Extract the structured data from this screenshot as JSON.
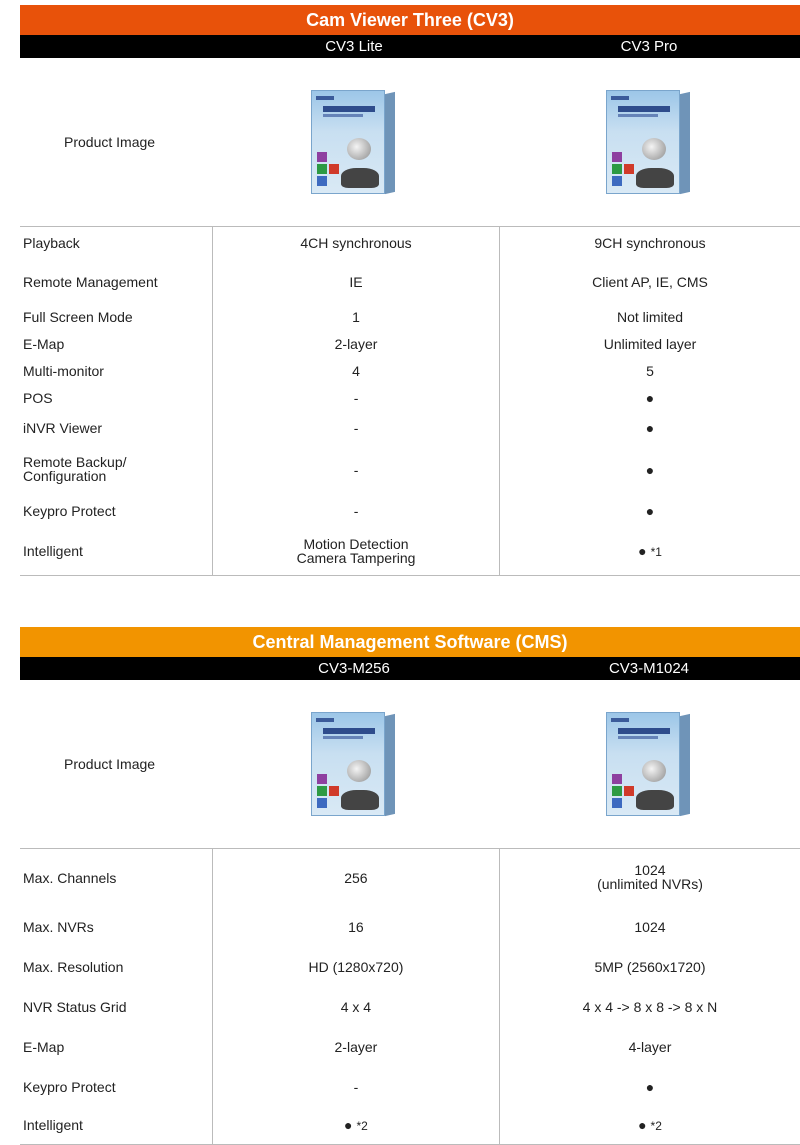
{
  "cv3": {
    "title": "Cam Viewer Three (CV3)",
    "col1": "CV3 Lite",
    "col2": "CV3 Pro",
    "image_label": "Product  Image",
    "rows": [
      {
        "label": "Playback",
        "v1": "4CH synchronous",
        "v2": "9CH synchronous"
      },
      {
        "label": "Remote Management",
        "v1": "IE",
        "v2": "Client AP, IE, CMS"
      },
      {
        "label": "Full Screen Mode",
        "v1": "1",
        "v2": "Not limited"
      },
      {
        "label": "E-Map",
        "v1": "2-layer",
        "v2": "Unlimited layer"
      },
      {
        "label": "Multi-monitor",
        "v1": "4",
        "v2": "5"
      },
      {
        "label": "POS",
        "v1": "-",
        "v2": "●"
      },
      {
        "label": "iNVR Viewer",
        "v1": "-",
        "v2": "●"
      },
      {
        "label": "Remote Backup/",
        "label2": "Configuration",
        "v1": "-",
        "v2": "●"
      },
      {
        "label": "Keypro Protect",
        "v1": "-",
        "v2": "●"
      },
      {
        "label": "Intelligent",
        "v1": "Motion Detection",
        "v1b": "Camera Tampering",
        "v2": "●",
        "v2note": "*1"
      }
    ]
  },
  "cms": {
    "title": "Central Management Software (CMS)",
    "col1": "CV3-M256",
    "col2": "CV3-M1024",
    "image_label": "Product  Image",
    "rows": [
      {
        "label": "Max. Channels",
        "v1": "256",
        "v2": "1024",
        "v2b": "(unlimited NVRs)"
      },
      {
        "label": "Max. NVRs",
        "v1": "16",
        "v2": "1024"
      },
      {
        "label": "Max. Resolution",
        "v1": "HD (1280x720)",
        "v2": "5MP (2560x1720)"
      },
      {
        "label": "NVR Status Grid",
        "v1": "4 x 4",
        "v2": "4 x 4 -> 8 x 8 -> 8 x N"
      },
      {
        "label": "E-Map",
        "v1": "2-layer",
        "v2": "4-layer"
      },
      {
        "label": "Keypro Protect",
        "v1": "-",
        "v2": "●"
      },
      {
        "label": "Intelligent",
        "v1": "●",
        "v1note": "*2",
        "v2": "●",
        "v2note": "*2"
      }
    ]
  }
}
